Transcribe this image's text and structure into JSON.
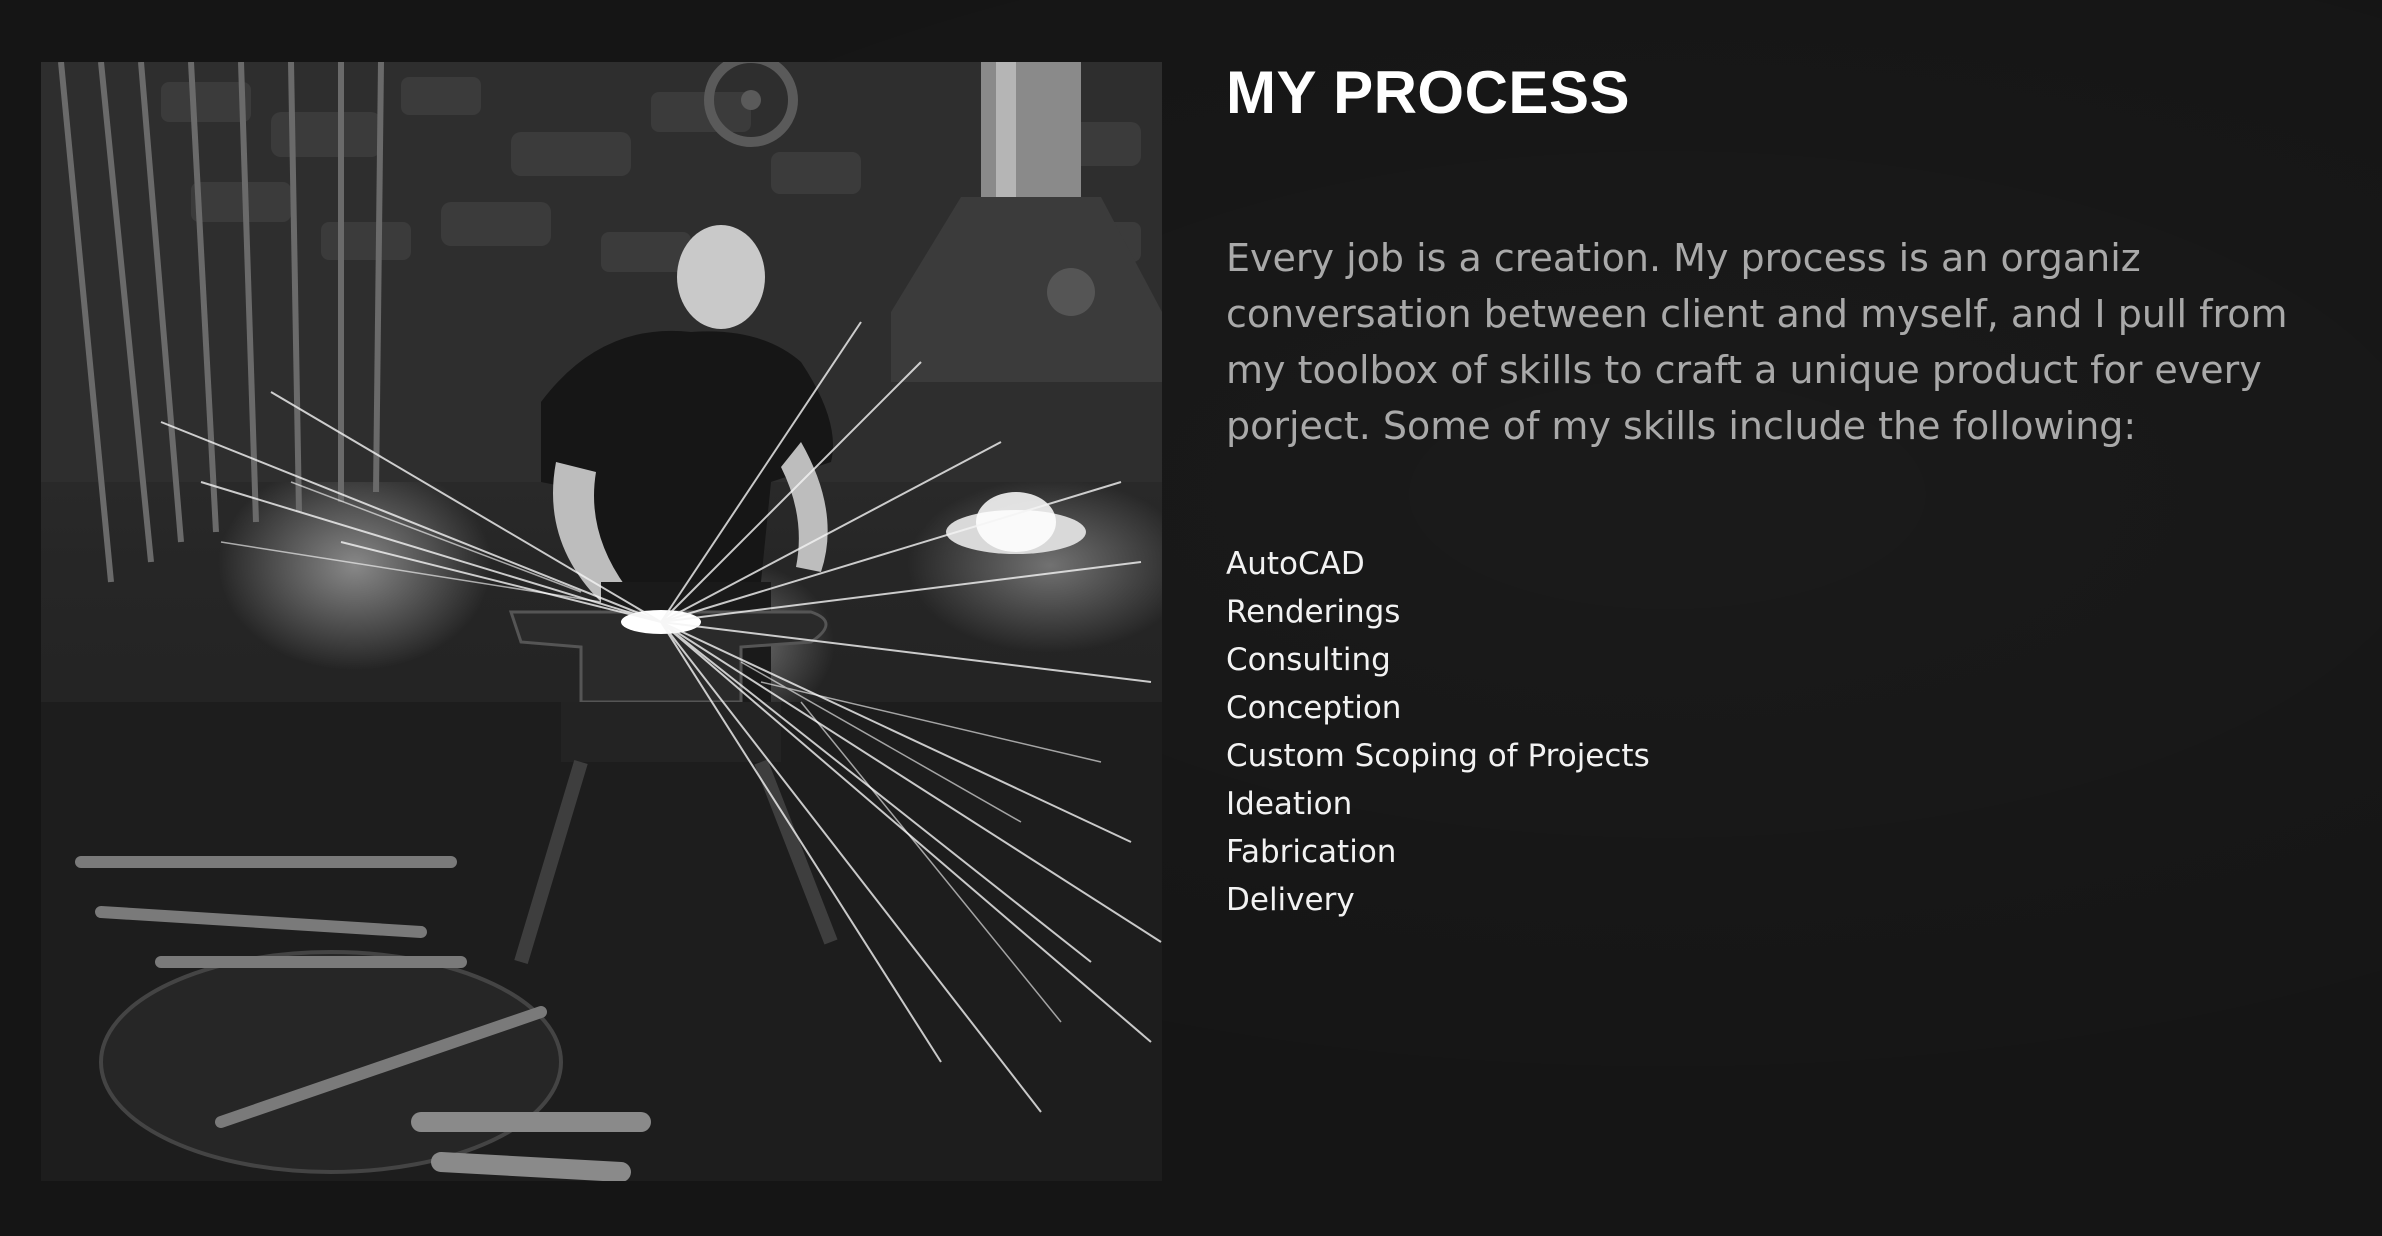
{
  "process": {
    "image_alt": "Blacksmith hammering glowing metal on an anvil with sparks flying",
    "title": "MY PROCESS",
    "intro": "Every job is a creation. My process is an organiz conversation between client and myself, and I pull from my toolbox of skills to craft a unique product for every porject. Some of my skills include the following:",
    "skills": [
      "AutoCAD",
      "Renderings",
      "Consulting",
      "Conception",
      "Custom Scoping of Projects",
      "Ideation",
      "Fabrication",
      "Delivery"
    ]
  }
}
